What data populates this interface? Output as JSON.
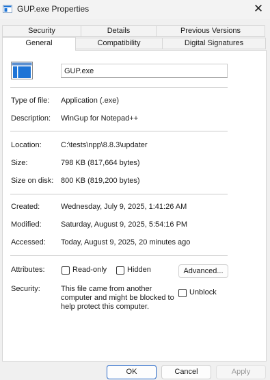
{
  "window": {
    "title": "GUP.exe Properties",
    "close_glyph": "✕"
  },
  "tabs": {
    "row1": [
      {
        "label": "Security"
      },
      {
        "label": "Details"
      },
      {
        "label": "Previous Versions"
      }
    ],
    "row2": [
      {
        "label": "General",
        "active": true
      },
      {
        "label": "Compatibility"
      },
      {
        "label": "Digital Signatures"
      }
    ]
  },
  "general": {
    "filename": "GUP.exe",
    "type_label": "Type of file:",
    "type_value": "Application (.exe)",
    "description_label": "Description:",
    "description_value": "WinGup for Notepad++",
    "location_label": "Location:",
    "location_value": "C:\\tests\\npp\\8.8.3\\updater",
    "size_label": "Size:",
    "size_value": "798 KB (817,664 bytes)",
    "size_on_disk_label": "Size on disk:",
    "size_on_disk_value": "800 KB (819,200 bytes)",
    "created_label": "Created:",
    "created_value": "Wednesday, July 9, 2025, 1:41:26 AM",
    "modified_label": "Modified:",
    "modified_value": "Saturday, August 9, 2025, 5:54:16 PM",
    "accessed_label": "Accessed:",
    "accessed_value": "Today, August 9, 2025, 20 minutes ago",
    "attributes_label": "Attributes:",
    "readonly_label": "Read-only",
    "readonly_checked": false,
    "hidden_label": "Hidden",
    "hidden_checked": false,
    "advanced_label": "Advanced...",
    "security_label": "Security:",
    "security_line1": "This file came from another",
    "security_line2": "computer and might be blocked to",
    "security_line3": "help protect this computer.",
    "unblock_label": "Unblock",
    "unblock_checked": false
  },
  "buttons": {
    "ok": "OK",
    "cancel": "Cancel",
    "apply": "Apply"
  },
  "colors": {
    "accent": "#2a6ac8",
    "icon_blue": "#1e74d6",
    "window_bg": "#f0f0f0",
    "panel_bg": "#ffffff"
  },
  "icons": {
    "title": "app-icon",
    "file": "exe-file-icon",
    "close": "close-icon"
  }
}
